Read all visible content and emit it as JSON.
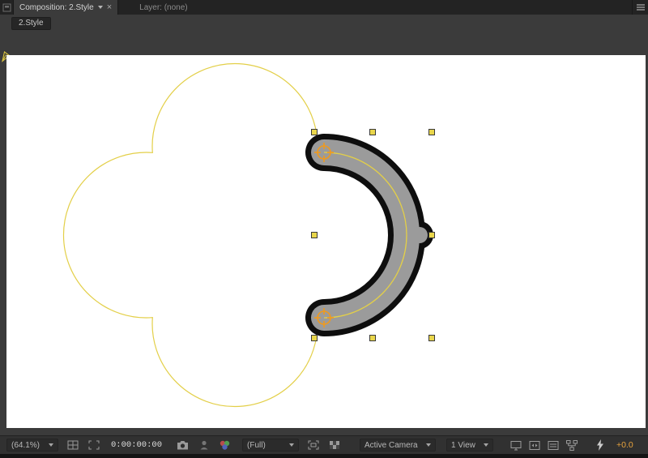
{
  "window": {
    "tabs": [
      {
        "label": "Composition: 2.Style"
      },
      {
        "label": "Layer: (none)"
      }
    ],
    "close_glyph": "×",
    "navigator_label": "2.Style"
  },
  "toolbar": {
    "zoom_value": "(64.1%)",
    "timecode": "0:00:00:00",
    "resolution_value": "(Full)",
    "camera_view_value": "Active Camera",
    "view_layout_value": "1 View",
    "exposure_value": "+0.0"
  },
  "icons": {
    "panel_grip": "panel-square",
    "panel_menu": "three-lines",
    "grid_options": "box-with-crosshair",
    "region_of_interest": "corner-ticks-box",
    "snapshot": "camera",
    "show_snapshot": "person-silhouette",
    "channels": "rgb-circles",
    "transparency_grid": "checkerboard",
    "shared_view": "monitor",
    "pixel_aspect": "box-with-arrows",
    "timeline": "box-with-bars",
    "flowchart": "connected-boxes",
    "fast_previews": "lightning-bolt",
    "pen_cursor": "pen-nib"
  },
  "colors": {
    "canvas_bg": "#ffffff",
    "path_yellow": "#e3cf48",
    "shape_fill": "#9b9b9b",
    "shape_outline": "#0e0e0e",
    "selection_handle": "#e9d64b",
    "handle_border": "#3a3a3a",
    "anchor_orange": "#f09a1d",
    "exposure_text": "#e8a33d"
  }
}
